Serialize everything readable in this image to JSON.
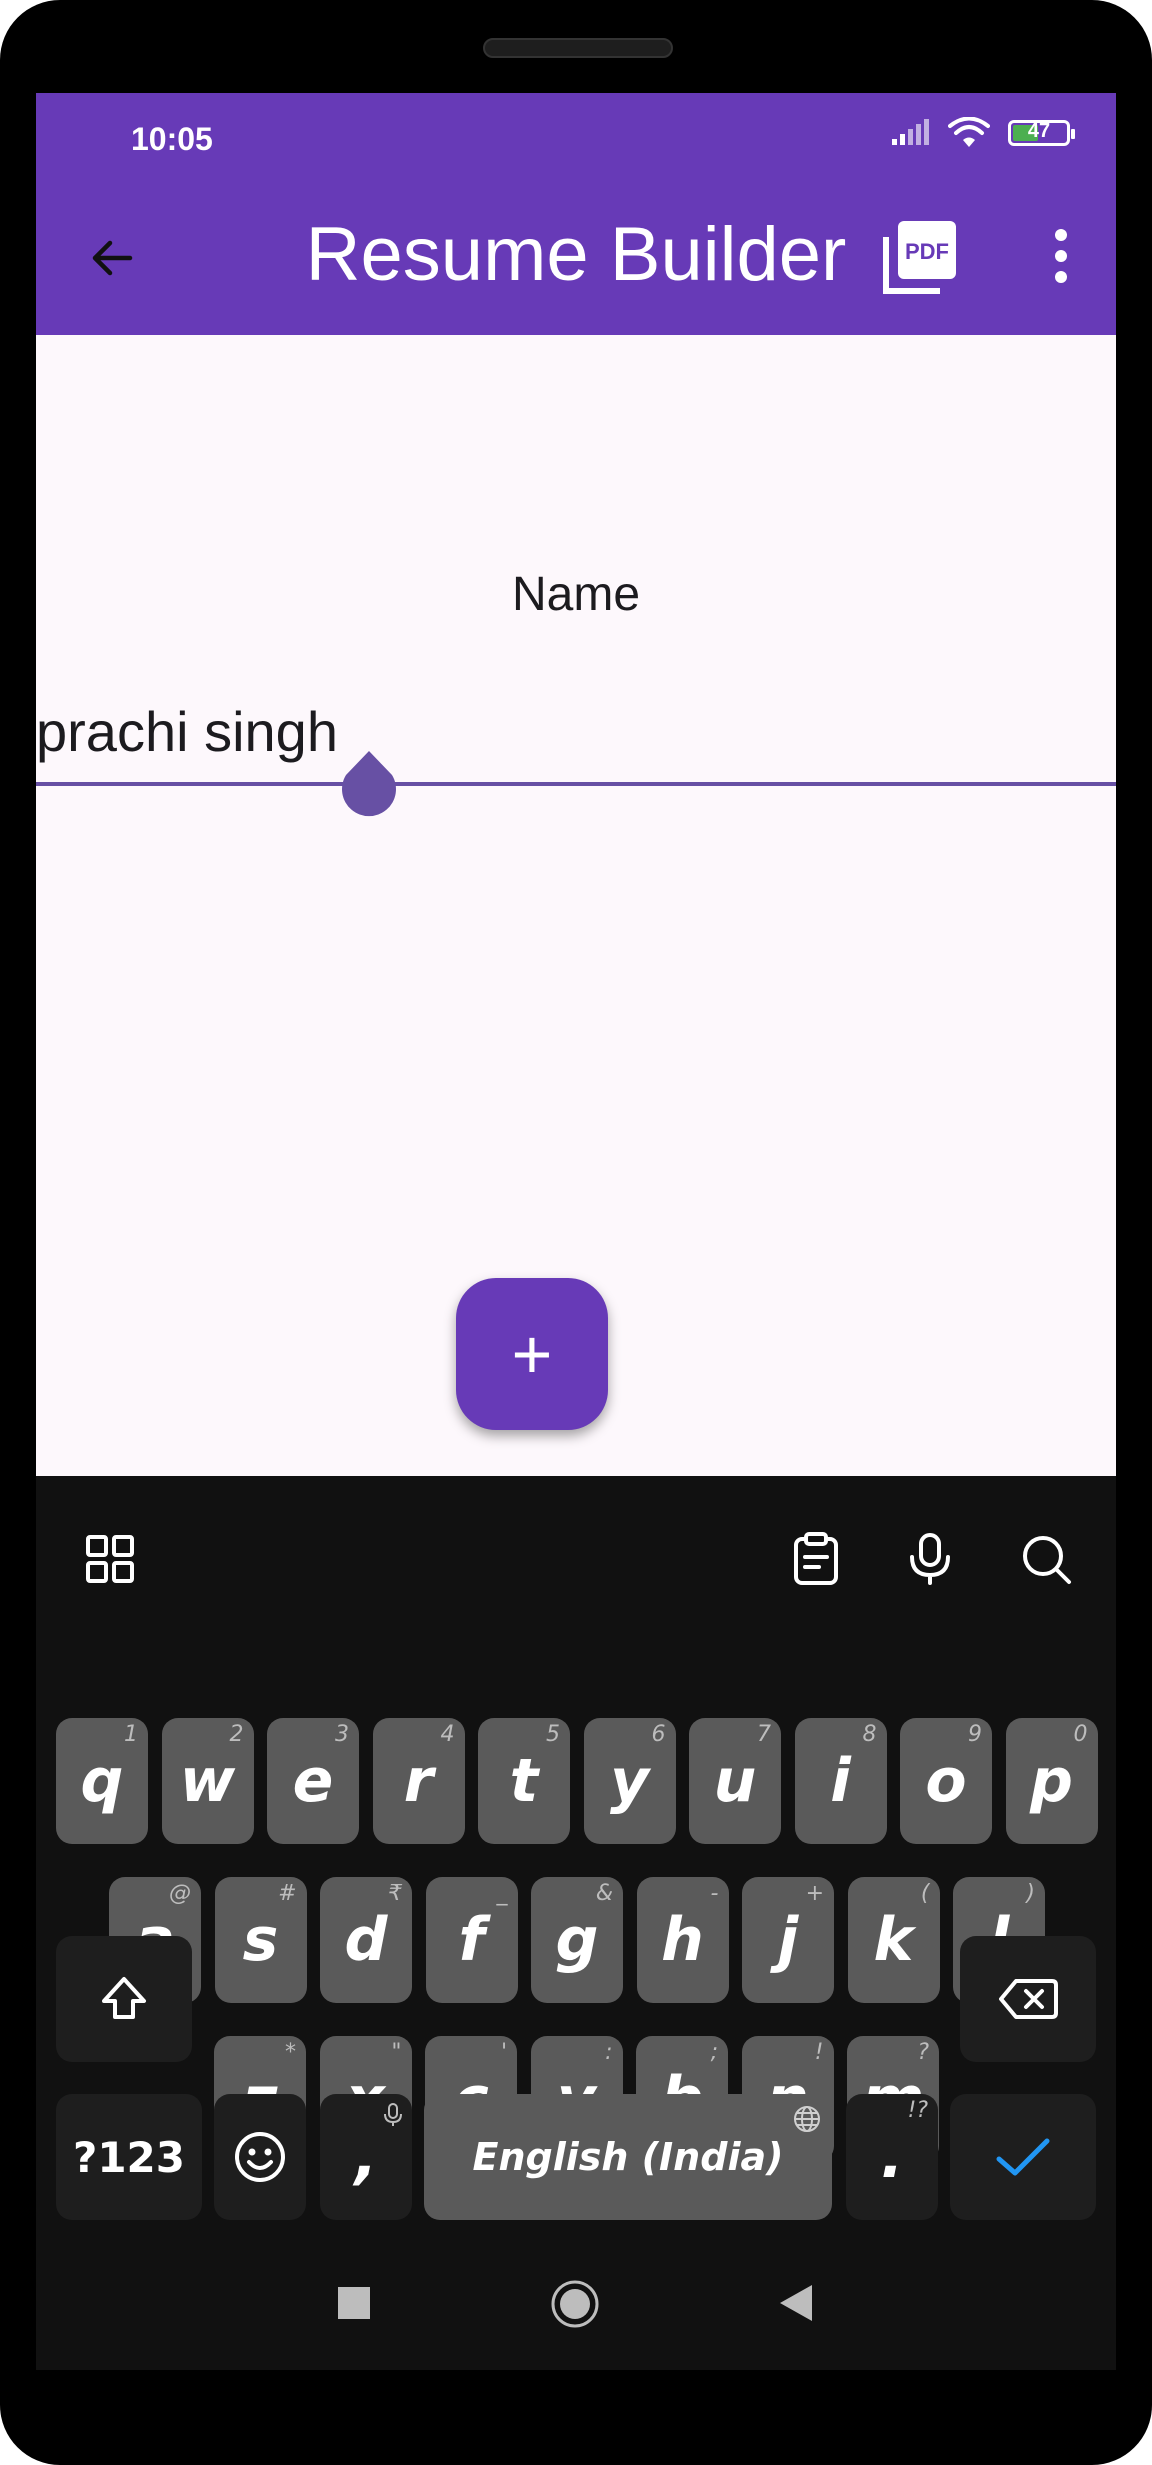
{
  "status_bar": {
    "time": "10:05",
    "battery": "47"
  },
  "app_bar": {
    "title": "Resume Builder"
  },
  "form": {
    "label": "Name",
    "value": "prachi singh"
  },
  "fab": {
    "label": "+"
  },
  "keyboard": {
    "row1": [
      {
        "key": "q",
        "hint": "1"
      },
      {
        "key": "w",
        "hint": "2"
      },
      {
        "key": "e",
        "hint": "3"
      },
      {
        "key": "r",
        "hint": "4"
      },
      {
        "key": "t",
        "hint": "5"
      },
      {
        "key": "y",
        "hint": "6"
      },
      {
        "key": "u",
        "hint": "7"
      },
      {
        "key": "i",
        "hint": "8"
      },
      {
        "key": "o",
        "hint": "9"
      },
      {
        "key": "p",
        "hint": "0"
      }
    ],
    "row2": [
      {
        "key": "a",
        "hint": "@"
      },
      {
        "key": "s",
        "hint": "#"
      },
      {
        "key": "d",
        "hint": "₹"
      },
      {
        "key": "f",
        "hint": "_"
      },
      {
        "key": "g",
        "hint": "&"
      },
      {
        "key": "h",
        "hint": "-"
      },
      {
        "key": "j",
        "hint": "+"
      },
      {
        "key": "k",
        "hint": "("
      },
      {
        "key": "l",
        "hint": ")"
      }
    ],
    "row3": [
      {
        "key": "z",
        "hint": "*"
      },
      {
        "key": "x",
        "hint": "\""
      },
      {
        "key": "c",
        "hint": "'"
      },
      {
        "key": "v",
        "hint": ":"
      },
      {
        "key": "b",
        "hint": ";"
      },
      {
        "key": "n",
        "hint": "!"
      },
      {
        "key": "m",
        "hint": "?"
      }
    ],
    "symbols_label": "?123",
    "comma": ",",
    "space_label": "English (India)",
    "period": ".",
    "period_hint": "!?"
  }
}
